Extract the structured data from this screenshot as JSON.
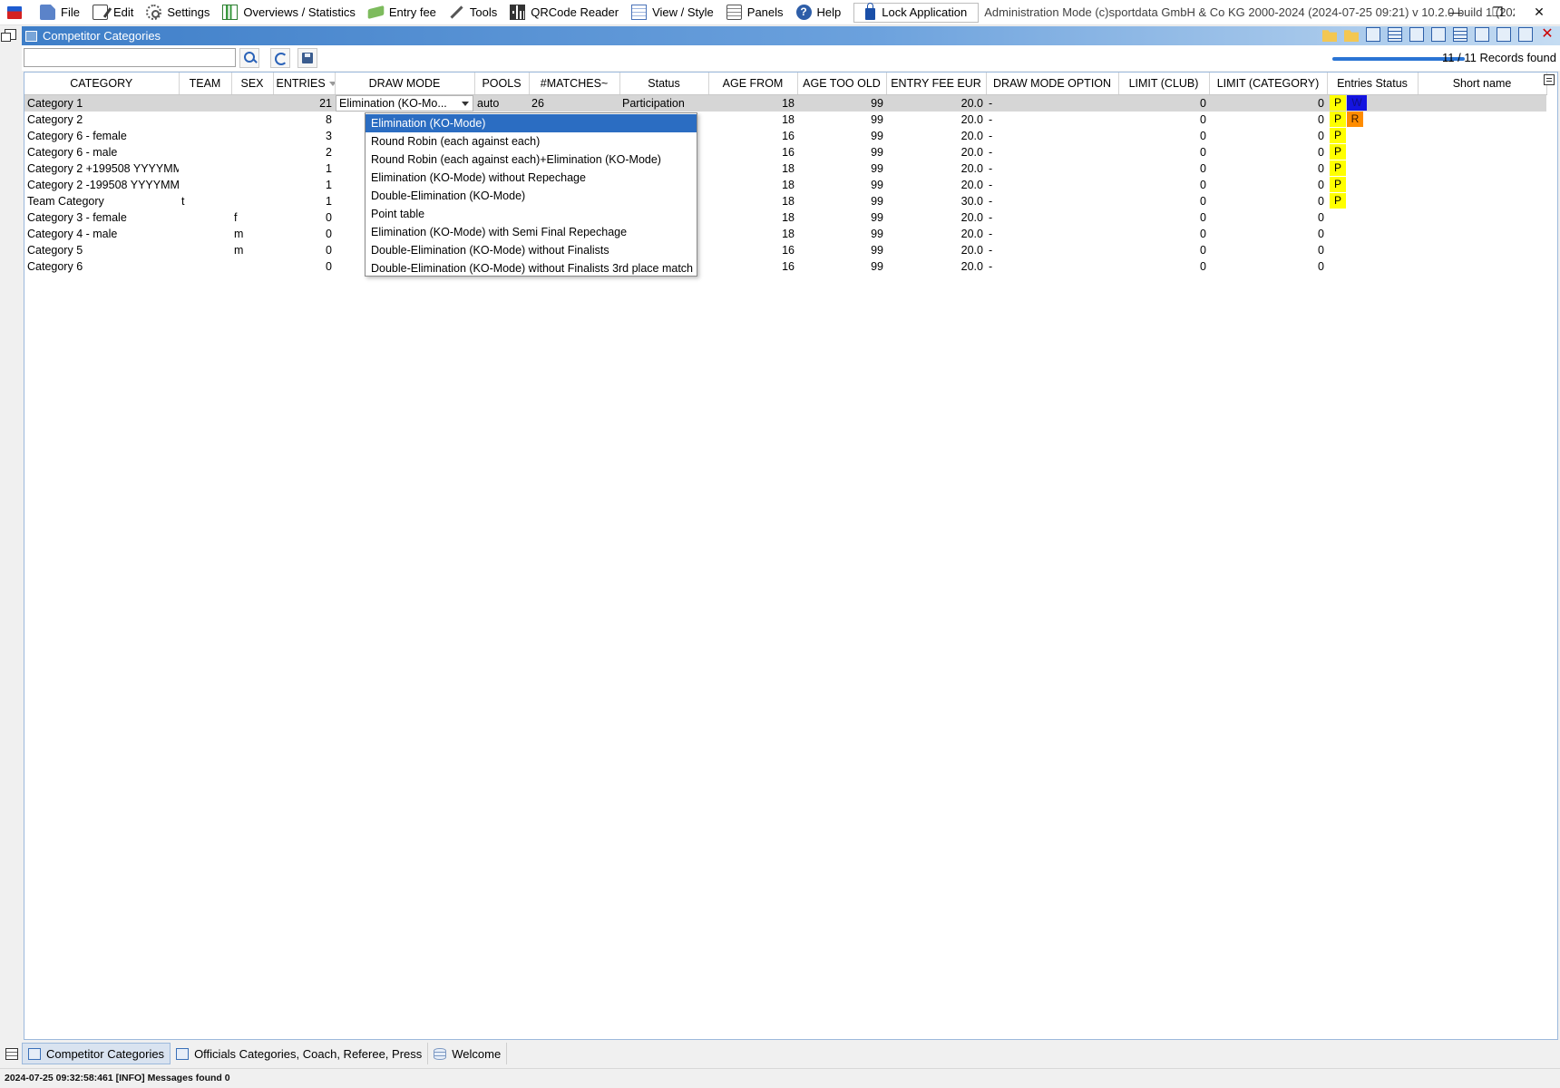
{
  "menu": {
    "items": [
      {
        "label": "File",
        "icon": "file-icon"
      },
      {
        "label": "Edit",
        "icon": "edit-icon"
      },
      {
        "label": "Settings",
        "icon": "gear-icon"
      },
      {
        "label": "Overviews / Statistics",
        "icon": "chart-icon"
      },
      {
        "label": "Entry fee",
        "icon": "money-icon"
      },
      {
        "label": "Tools",
        "icon": "tools-icon"
      },
      {
        "label": "QRCode Reader",
        "icon": "qrcode-icon"
      },
      {
        "label": "View / Style",
        "icon": "view-icon"
      },
      {
        "label": "Panels",
        "icon": "panels-icon"
      },
      {
        "label": "Help",
        "icon": "help-icon"
      }
    ],
    "lock_label": "Lock Application",
    "title": "Administration Mode (c)sportdata GmbH & Co KG 2000-2024 (2024-07-25 09:21)  v 10.2.0 build 1 (2024-06...",
    "win_min": "—",
    "win_max": "❐",
    "win_close": "✕"
  },
  "panel": {
    "title": "Competitor Categories",
    "search_value": "",
    "records_found": "11 / 11 Records found",
    "progress_percent": 100
  },
  "columns": [
    "CATEGORY",
    "TEAM",
    "SEX",
    "ENTRIES",
    "DRAW MODE",
    "POOLS",
    "#MATCHES~",
    "Status",
    "AGE FROM",
    "AGE TOO OLD",
    "ENTRY FEE EUR",
    "DRAW MODE OPTION",
    "LIMIT (CLUB)",
    "LIMIT (CATEGORY)",
    "Entries Status",
    "Short name"
  ],
  "rows": [
    {
      "category": "Category 1",
      "team": "",
      "sex": "",
      "entries": "21",
      "draw_mode": "Elimination (KO-Mo...",
      "pools": "auto",
      "matches": "26",
      "status": "Participation",
      "age_from": "18",
      "age_too_old": "99",
      "fee": "20.0",
      "draw_option": "-",
      "limit_club": "0",
      "limit_cat": "0",
      "badges": [
        "P",
        "W"
      ],
      "short": ""
    },
    {
      "category": "Category 2",
      "team": "",
      "sex": "",
      "entries": "8",
      "draw_mode": "",
      "pools": "",
      "matches": "",
      "status": "ation",
      "age_from": "18",
      "age_too_old": "99",
      "fee": "20.0",
      "draw_option": "-",
      "limit_club": "0",
      "limit_cat": "0",
      "badges": [
        "P",
        "R"
      ],
      "short": ""
    },
    {
      "category": "Category 6 - female",
      "team": "",
      "sex": "",
      "entries": "3",
      "draw_mode": "",
      "pools": "",
      "matches": "",
      "status": "ation",
      "age_from": "16",
      "age_too_old": "99",
      "fee": "20.0",
      "draw_option": "-",
      "limit_club": "0",
      "limit_cat": "0",
      "badges": [
        "P"
      ],
      "short": ""
    },
    {
      "category": "Category 6 - male",
      "team": "",
      "sex": "",
      "entries": "2",
      "draw_mode": "",
      "pools": "",
      "matches": "",
      "status": "ation",
      "age_from": "16",
      "age_too_old": "99",
      "fee": "20.0",
      "draw_option": "-",
      "limit_club": "0",
      "limit_cat": "0",
      "badges": [
        "P"
      ],
      "short": ""
    },
    {
      "category": "Category 2 +199508 YYYYMM",
      "team": "",
      "sex": "",
      "entries": "1",
      "draw_mode": "",
      "pools": "",
      "matches": "",
      "status": "ation",
      "age_from": "18",
      "age_too_old": "99",
      "fee": "20.0",
      "draw_option": "-",
      "limit_club": "0",
      "limit_cat": "0",
      "badges": [
        "P"
      ],
      "short": ""
    },
    {
      "category": "Category 2 -199508 YYYYMM",
      "team": "",
      "sex": "",
      "entries": "1",
      "draw_mode": "",
      "pools": "",
      "matches": "",
      "status": "ation",
      "age_from": "18",
      "age_too_old": "99",
      "fee": "20.0",
      "draw_option": "-",
      "limit_club": "0",
      "limit_cat": "0",
      "badges": [
        "P"
      ],
      "short": ""
    },
    {
      "category": "Team Category",
      "team": "t",
      "sex": "",
      "entries": "1",
      "draw_mode": "",
      "pools": "",
      "matches": "",
      "status": "ation",
      "age_from": "18",
      "age_too_old": "99",
      "fee": "30.0",
      "draw_option": "-",
      "limit_club": "0",
      "limit_cat": "0",
      "badges": [
        "P"
      ],
      "short": ""
    },
    {
      "category": "Category 3 - female",
      "team": "",
      "sex": "f",
      "entries": "0",
      "draw_mode": "",
      "pools": "",
      "matches": "",
      "status": "ation",
      "age_from": "18",
      "age_too_old": "99",
      "fee": "20.0",
      "draw_option": "-",
      "limit_club": "0",
      "limit_cat": "0",
      "badges": [],
      "short": ""
    },
    {
      "category": "Category 4 - male",
      "team": "",
      "sex": "m",
      "entries": "0",
      "draw_mode": "",
      "pools": "",
      "matches": "",
      "status": "ation",
      "age_from": "18",
      "age_too_old": "99",
      "fee": "20.0",
      "draw_option": "-",
      "limit_club": "0",
      "limit_cat": "0",
      "badges": [],
      "short": ""
    },
    {
      "category": "Category 5",
      "team": "",
      "sex": "m",
      "entries": "0",
      "draw_mode": "",
      "pools": "",
      "matches": "",
      "status": "ation",
      "age_from": "16",
      "age_too_old": "99",
      "fee": "20.0",
      "draw_option": "-",
      "limit_club": "0",
      "limit_cat": "0",
      "badges": [],
      "short": ""
    },
    {
      "category": "Category 6",
      "team": "",
      "sex": "",
      "entries": "0",
      "draw_mode": "",
      "pools": "",
      "matches": "",
      "status": "ation",
      "age_from": "16",
      "age_too_old": "99",
      "fee": "20.0",
      "draw_option": "-",
      "limit_club": "0",
      "limit_cat": "0",
      "badges": [],
      "short": ""
    }
  ],
  "dropdown": {
    "selected_index": 0,
    "options": [
      "Elimination (KO-Mode)",
      "Round Robin (each against each)",
      "Round Robin (each against each)+Elimination (KO-Mode)",
      "Elimination (KO-Mode) without Repechage",
      "Double-Elimination (KO-Mode)",
      "Point table",
      "Elimination (KO-Mode) with Semi Final Repechage",
      "Double-Elimination (KO-Mode) without Finalists",
      "Double-Elimination (KO-Mode) without Finalists 3rd place match"
    ]
  },
  "tabs": [
    {
      "label": "Competitor Categories",
      "active": true
    },
    {
      "label": "Officials Categories, Coach, Referee, Press",
      "active": false
    },
    {
      "label": "Welcome",
      "active": false
    }
  ],
  "status_bar": "2024-07-25 09:32:58:461 [INFO] Messages found 0",
  "colors": {
    "accent": "#2b6dc2",
    "header_gradient_start": "#3e7ec8",
    "badge_participation": "#ffff00",
    "badge_w": "#1414e0",
    "badge_r": "#ff8c00"
  }
}
